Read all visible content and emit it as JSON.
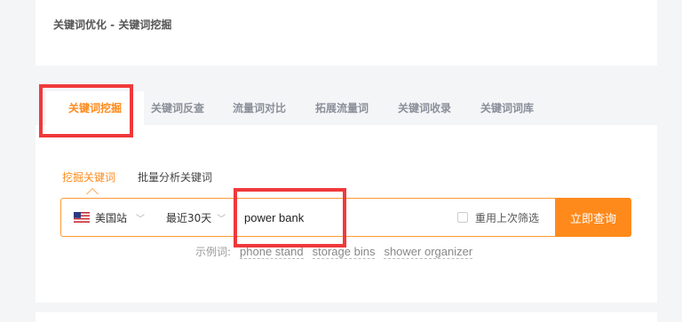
{
  "breadcrumb": "关键词优化 - 关键词挖掘",
  "tabs": [
    {
      "label": "关键词挖掘",
      "active": true
    },
    {
      "label": "关键词反查"
    },
    {
      "label": "流量词对比"
    },
    {
      "label": "拓展流量词"
    },
    {
      "label": "关键词收录"
    },
    {
      "label": "关键词词库"
    }
  ],
  "subtabs": [
    {
      "label": "挖掘关键词",
      "active": true
    },
    {
      "label": "批量分析关键词"
    }
  ],
  "search": {
    "site": "美国站",
    "period": "最近30天",
    "keyword": "power bank",
    "reuse_label": "重用上次筛选",
    "button": "立即查询"
  },
  "examples": {
    "label": "示例词:",
    "items": [
      "phone stand",
      "storage bins",
      "shower organizer"
    ]
  },
  "colors": {
    "accent": "#ff8a1c",
    "highlight": "#f0393b"
  }
}
